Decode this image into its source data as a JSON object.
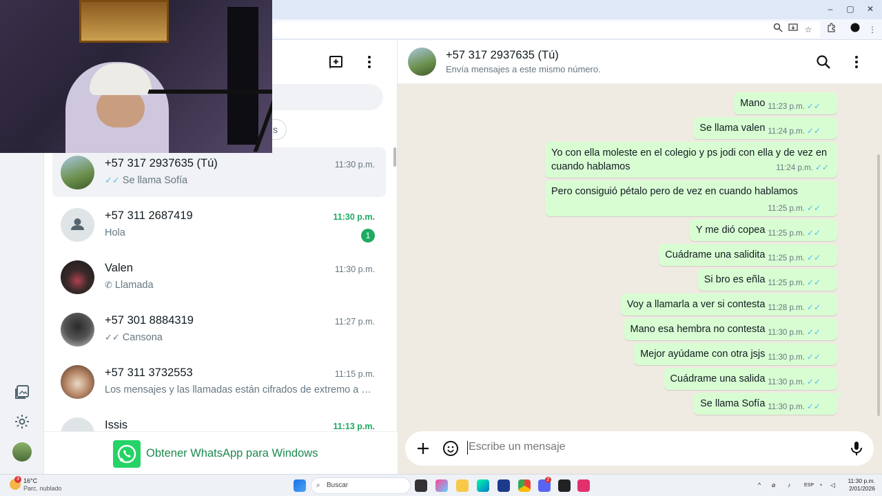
{
  "colors": {
    "wa_green": "#25d366",
    "bubble_out": "#d9fdd3",
    "chat_bg": "#efeae2",
    "read_ticks": "#53bdeb",
    "unread": "#1daa61"
  },
  "browser": {
    "window_controls": [
      "–",
      "▢",
      "✕"
    ],
    "address_icons": [
      "zoom-icon",
      "install-app-icon",
      "star-icon",
      "extensions-icon",
      "profile-icon",
      "menu-icon"
    ]
  },
  "sidebar_rail": {
    "icons": [
      "status-icon",
      "media-icon",
      "settings-icon",
      "profile-avatar"
    ]
  },
  "chat_list": {
    "header_icons": [
      "new-chat-icon",
      "menu-icon"
    ],
    "filter_chip_partial": "s",
    "chats": [
      {
        "name": "+57 317 2937635 (Tú)",
        "time": "11:30 p.m.",
        "preview": "Se llama Sofía",
        "status": "read",
        "active": true,
        "unread": false
      },
      {
        "name": "+57 311 2687419",
        "time": "11:30 p.m.",
        "preview": "Hola",
        "status": "none",
        "active": false,
        "unread": true,
        "unread_count": "1"
      },
      {
        "name": "Valen",
        "time": "11:30 p.m.",
        "preview": "Llamada",
        "status": "call",
        "active": false,
        "unread": false
      },
      {
        "name": "+57 301 8884319",
        "time": "11:27 p.m.",
        "preview": "Cansona",
        "status": "delivered",
        "active": false,
        "unread": false
      },
      {
        "name": "+57 311 3732553",
        "time": "11:15 p.m.",
        "preview": "Los mensajes y las llamadas están cifrados de extremo a extremo.",
        "status": "none",
        "active": false,
        "unread": false
      },
      {
        "name": "Issis",
        "time": "11:13 p.m.",
        "preview": "",
        "status": "none",
        "active": false,
        "unread": true
      }
    ],
    "get_whatsapp": "Obtener WhatsApp para Windows"
  },
  "conversation": {
    "name": "+57 317 2937635 (Tú)",
    "subtitle": "Envía mensajes a este mismo número.",
    "messages": [
      {
        "text": "Mano",
        "time": "11:23 p.m."
      },
      {
        "text": "Se llama valen",
        "time": "11:24 p.m."
      },
      {
        "text": "Yo con ella moleste en el colegio y ps jodi con ella y de vez en cuando hablamos",
        "time": "11:24 p.m."
      },
      {
        "text": "Pero consiguió pétalo pero de vez en cuando hablamos",
        "time": "11:25 p.m."
      },
      {
        "text": "Y me dió copea",
        "time": "11:25 p.m."
      },
      {
        "text": "Cuádrame una salidita",
        "time": "11:25 p.m."
      },
      {
        "text": "Si bro es eñla",
        "time": "11:25 p.m."
      },
      {
        "text": "Voy a llamarla a ver si contesta",
        "time": "11:28 p.m."
      },
      {
        "text": "Mano esa hembra no contesta",
        "time": "11:30 p.m."
      },
      {
        "text": "Mejor ayúdame con otra jsjs",
        "time": "11:30 p.m."
      },
      {
        "text": "Cuádrame una salida",
        "time": "11:30 p.m."
      },
      {
        "text": "Se llama Sofía",
        "time": "11:30 p.m."
      }
    ],
    "composer_placeholder": "Escribe un mensaje"
  },
  "taskbar": {
    "weather_badge": "3",
    "weather_temp": "16°C",
    "weather_desc": "Parc. nublado",
    "search_label": "Buscar",
    "badge_discord": "2",
    "lang": "ESP",
    "time": "11:30 p.m.",
    "date": "2/01/2026"
  }
}
